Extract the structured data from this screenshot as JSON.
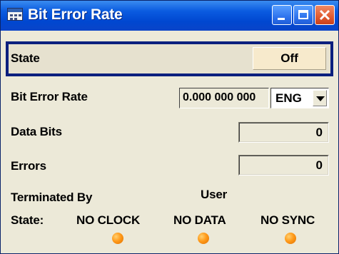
{
  "window": {
    "title": "Bit Error Rate",
    "icon": "table-window-icon",
    "controls": [
      "minimize-icon",
      "maximize-icon",
      "close-icon"
    ]
  },
  "state": {
    "label": "State",
    "button_label": "Off"
  },
  "bit_error_rate": {
    "label": "Bit Error Rate",
    "value": "0.000 000 000",
    "unit": "ENG"
  },
  "data_bits": {
    "label": "Data Bits",
    "value": "0"
  },
  "errors": {
    "label": "Errors",
    "value": "0"
  },
  "terminated_by": {
    "label": "Terminated By",
    "value": "User"
  },
  "status": {
    "label": "State:",
    "indicators": [
      {
        "label": "NO CLOCK",
        "color": "#ff8c00"
      },
      {
        "label": "NO DATA",
        "color": "#ff8c00"
      },
      {
        "label": "NO SYNC",
        "color": "#ff8c00"
      }
    ]
  },
  "colors": {
    "titlebar": "#0047d0",
    "frame_highlight": "#0b1f7e",
    "state_button": "#f7eacc",
    "led": "#ff8c00"
  }
}
